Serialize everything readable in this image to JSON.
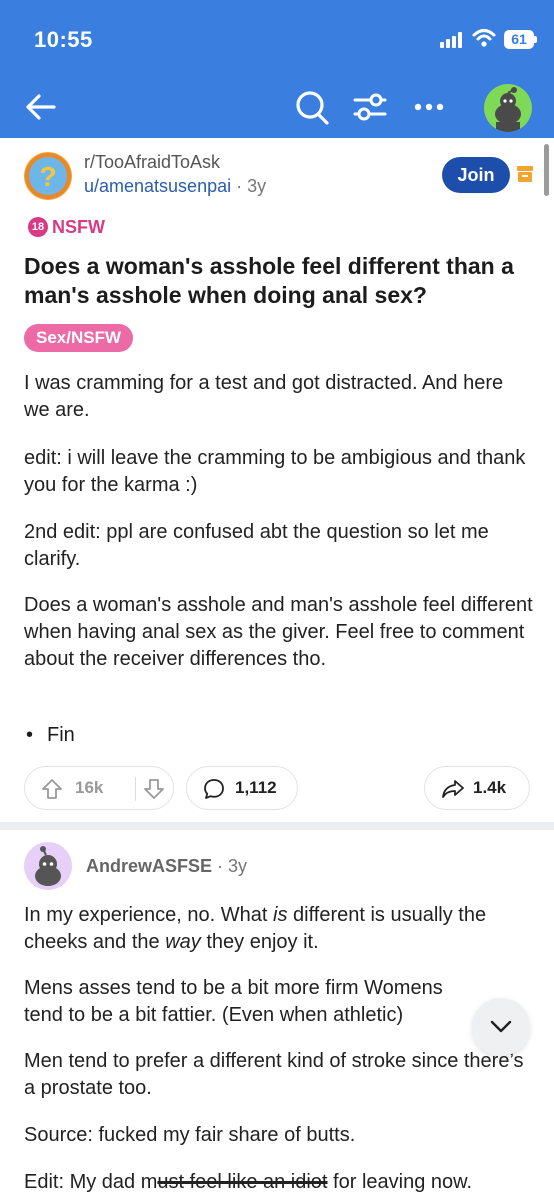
{
  "status_bar": {
    "time": "10:55",
    "battery": "61"
  },
  "icons": {
    "back": "arrow-left-icon",
    "search": "search-icon",
    "filter": "sliders-icon",
    "more": "more-horizontal-icon",
    "profile": "avatar-icon",
    "archive": "archive-icon",
    "upvote": "arrow-up-icon",
    "downvote": "arrow-down-icon",
    "comment": "comment-bubble-icon",
    "share": "share-arrow-icon",
    "collapse": "chevron-down-icon"
  },
  "colors": {
    "header": "#3a7fe0",
    "join": "#1e4eab",
    "nsfw": "#d93a84",
    "flair": "#ec6aa5",
    "user_link": "#2a5db0"
  },
  "post": {
    "subreddit": "r/TooAfraidToAsk",
    "author": "u/amenatsusenpai",
    "age": "3y",
    "join_label": "Join",
    "nsfw_badge": "18",
    "nsfw_label": "NSFW",
    "title": "Does a woman's asshole feel different than a man's asshole when doing anal sex?",
    "flair": "Sex/NSFW",
    "paragraphs": [
      "I was cramming for a test and got distracted. And here we are.",
      "edit: i  will leave the cramming to be ambigious and thank you  for the karma :)",
      "2nd edit: ppl are confused abt the question so let me clarify.",
      "Does a woman's asshole and man's asshole feel different when having anal sex as the giver. Feel free to comment about the receiver differences tho."
    ],
    "bullet_marker": "•",
    "bullet": "Fin",
    "votes": "16k",
    "comments": "1,112",
    "shares": "1.4k"
  },
  "comment": {
    "author": "AndrewASFSE",
    "age": "3y",
    "p1_a": "In my experience, no. What ",
    "p1_em1": "is",
    "p1_b": " different is usually the cheeks and the ",
    "p1_em2": "way",
    "p1_c": " they enjoy it.",
    "p2": "Mens asses tend to be a bit more firm Womens tend to be a bit fattier. (Even when athletic)",
    "p3": "Men tend to prefer a different kind of stroke since there’s a prostate too.",
    "p4": "Source: fucked my fair share of butts.",
    "p5_a": "Edit: My dad m",
    "p5_strike": "ust feel like an idiot",
    "p5_b": " for leaving now."
  }
}
